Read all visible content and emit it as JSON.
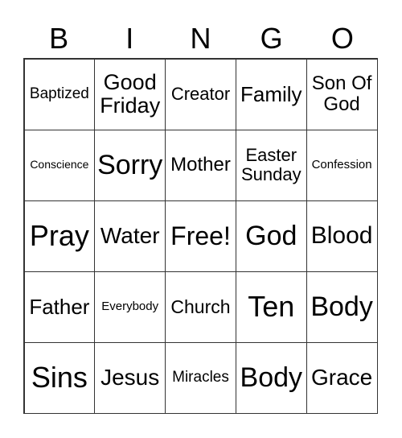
{
  "header": [
    "B",
    "I",
    "N",
    "G",
    "O"
  ],
  "cells": [
    "Baptized",
    "Good\nFriday",
    "Creator",
    "Family",
    "Son Of\nGod",
    "Conscience",
    "Sorry",
    "Mother",
    "Easter\nSunday",
    "Confession",
    "Pray",
    "Water",
    "Free!",
    "God",
    "Blood",
    "Father",
    "Everybody",
    "Church",
    "Ten",
    "Body",
    "Sins",
    "Jesus",
    "Miracles",
    "Body",
    "Grace"
  ]
}
